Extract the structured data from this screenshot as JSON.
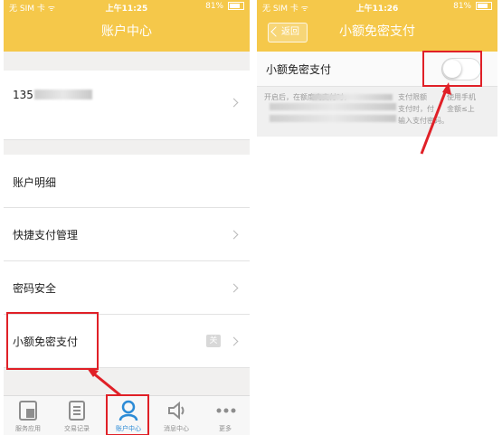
{
  "left": {
    "status": {
      "carrier": "无 SIM 卡 ᯤ",
      "time": "上午11:25",
      "battery": "81%",
      "battery_level": 0.81
    },
    "nav_title": "账户中心",
    "account_number": "135",
    "rows": {
      "account_detail": "账户明细",
      "quick_pay": "快捷支付管理",
      "password": "密码安全",
      "small_pay": "小额免密支付",
      "small_pay_badge": "关"
    },
    "tabs": [
      {
        "label": "服务应用",
        "icon": "apps-icon"
      },
      {
        "label": "交易记录",
        "icon": "records-icon"
      },
      {
        "label": "账户中心",
        "icon": "user-icon",
        "active": true
      },
      {
        "label": "消息中心",
        "icon": "speaker-icon"
      },
      {
        "label": "更多",
        "icon": "more-icon"
      }
    ]
  },
  "right": {
    "status": {
      "carrier": "无 SIM 卡 ᯤ",
      "time": "上午11:26",
      "battery": "81%",
      "battery_level": 0.81
    },
    "nav_title": "小额免密支付",
    "back_label": "返回",
    "toggle_label": "小额免密支付",
    "toggle_on": false,
    "desc_line1": "开启后，在额度内支付时，",
    "desc_line2a": "支付限额",
    "desc_line2b": "使用手机",
    "desc_line3a": "支付时，付",
    "desc_line3b": "金额≤上",
    "desc_line4": "输入支付密码。"
  },
  "colors": {
    "brand": "#f5c84a",
    "annotation": "#e02027",
    "active_tab": "#2c8bd6"
  }
}
